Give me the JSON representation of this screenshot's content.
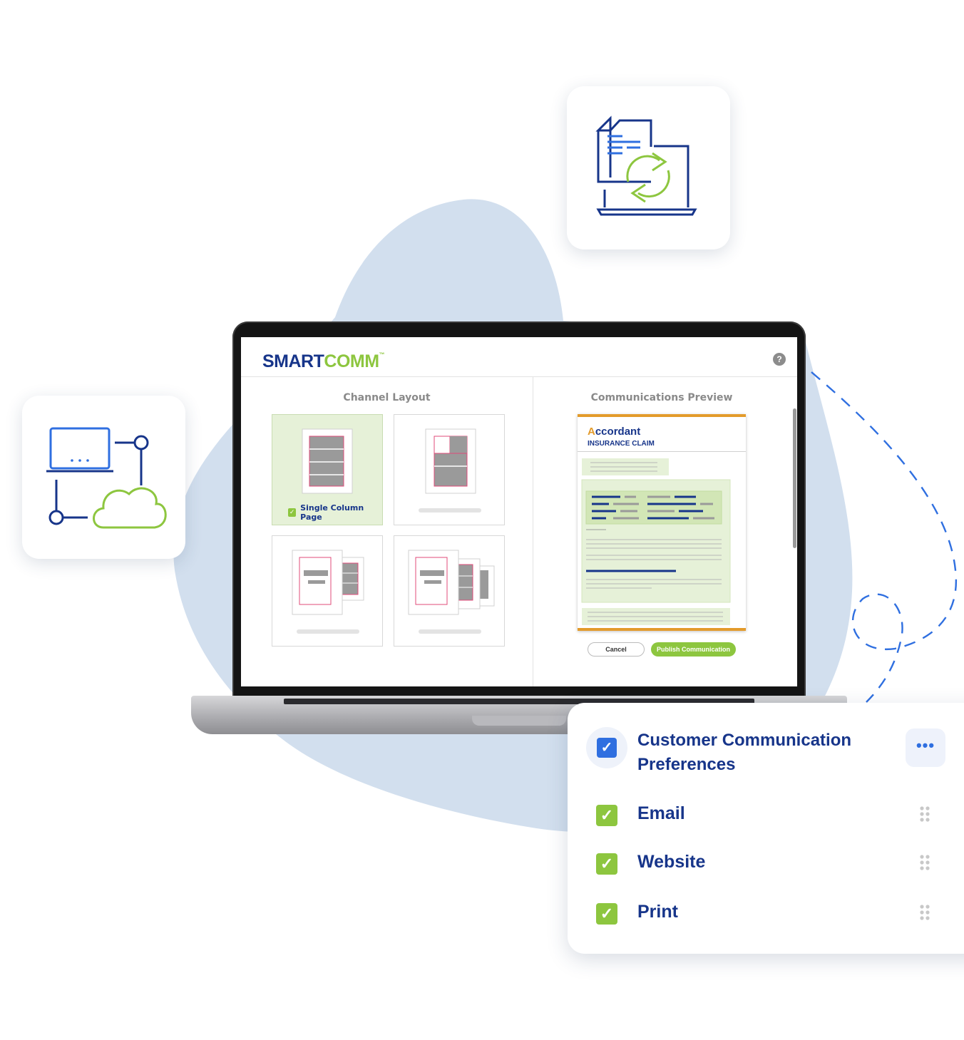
{
  "app": {
    "logo_primary": "SMART",
    "logo_secondary": "COMM",
    "logo_tm": "™",
    "help_label": "?"
  },
  "channel_layout": {
    "title": "Channel Layout",
    "selected_label": "Single Column Page"
  },
  "preview": {
    "title": "Communications Preview",
    "brand_first_letter": "A",
    "brand_rest": "ccordant",
    "doc_subtitle": "INSURANCE CLAIM",
    "cancel_label": "Cancel",
    "publish_label": "Publish Communication"
  },
  "preferences": {
    "title": "Customer Communication Preferences",
    "more_label": "•••",
    "items": [
      {
        "label": "Email"
      },
      {
        "label": "Website"
      },
      {
        "label": "Print"
      }
    ]
  },
  "colors": {
    "brand_navy": "#17358a",
    "brand_green": "#8dc63f",
    "accent_blue": "#2f6fe0",
    "doc_orange": "#e39b2b",
    "blob": "#d2dfee"
  },
  "icons": [
    "document-sync-laptop-icon",
    "laptop-cloud-network-icon",
    "help-icon",
    "check-icon",
    "drag-handle-icon",
    "more-icon"
  ]
}
